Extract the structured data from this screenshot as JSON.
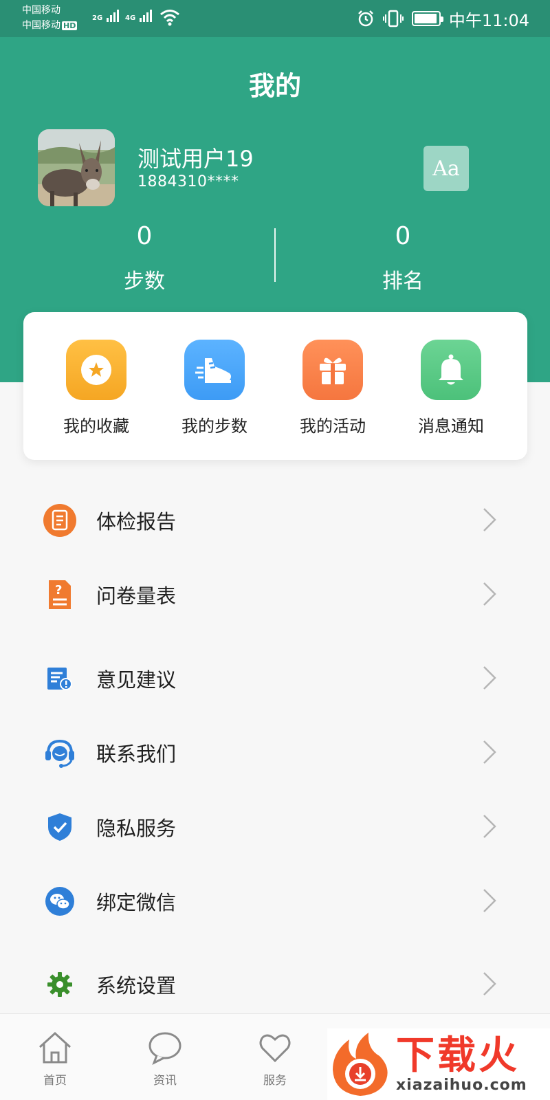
{
  "status_bar": {
    "carrier_1": "中国移动",
    "carrier_2": "中国移动",
    "hd_badge": "HD",
    "network_1": "2G",
    "network_2": "4G",
    "time": "中午11:04"
  },
  "header": {
    "title": "我的",
    "username": "测试用户19",
    "phone": "1884310****",
    "font_button": "Aa",
    "stats": [
      {
        "value": "0",
        "label": "步数"
      },
      {
        "value": "0",
        "label": "排名"
      }
    ]
  },
  "quick_actions": [
    {
      "label": "我的收藏",
      "icon": "star-icon",
      "color": "#f5a623"
    },
    {
      "label": "我的步数",
      "icon": "shoe-icon",
      "color": "#3d9bf5"
    },
    {
      "label": "我的活动",
      "icon": "gift-icon",
      "color": "#f5763f"
    },
    {
      "label": "消息通知",
      "icon": "bell-icon",
      "color": "#4cc17a"
    }
  ],
  "menu": [
    {
      "label": "体检报告",
      "icon": "report-icon"
    },
    {
      "label": "问卷量表",
      "icon": "questionnaire-icon"
    },
    {
      "label": "意见建议",
      "icon": "feedback-icon"
    },
    {
      "label": "联系我们",
      "icon": "headset-icon"
    },
    {
      "label": "隐私服务",
      "icon": "shield-icon"
    },
    {
      "label": "绑定微信",
      "icon": "wechat-icon"
    },
    {
      "label": "系统设置",
      "icon": "gear-icon"
    }
  ],
  "tabs": [
    {
      "label": "首页",
      "icon": "home-icon"
    },
    {
      "label": "资讯",
      "icon": "chat-bubble-icon"
    },
    {
      "label": "服务",
      "icon": "heart-icon"
    }
  ],
  "watermark": {
    "title": "下载火",
    "url": "xiazaihuo.com"
  },
  "colors": {
    "header_bg": "#2fa585",
    "status_bg": "#2a8f74",
    "page_bg": "#f7f7f7"
  }
}
